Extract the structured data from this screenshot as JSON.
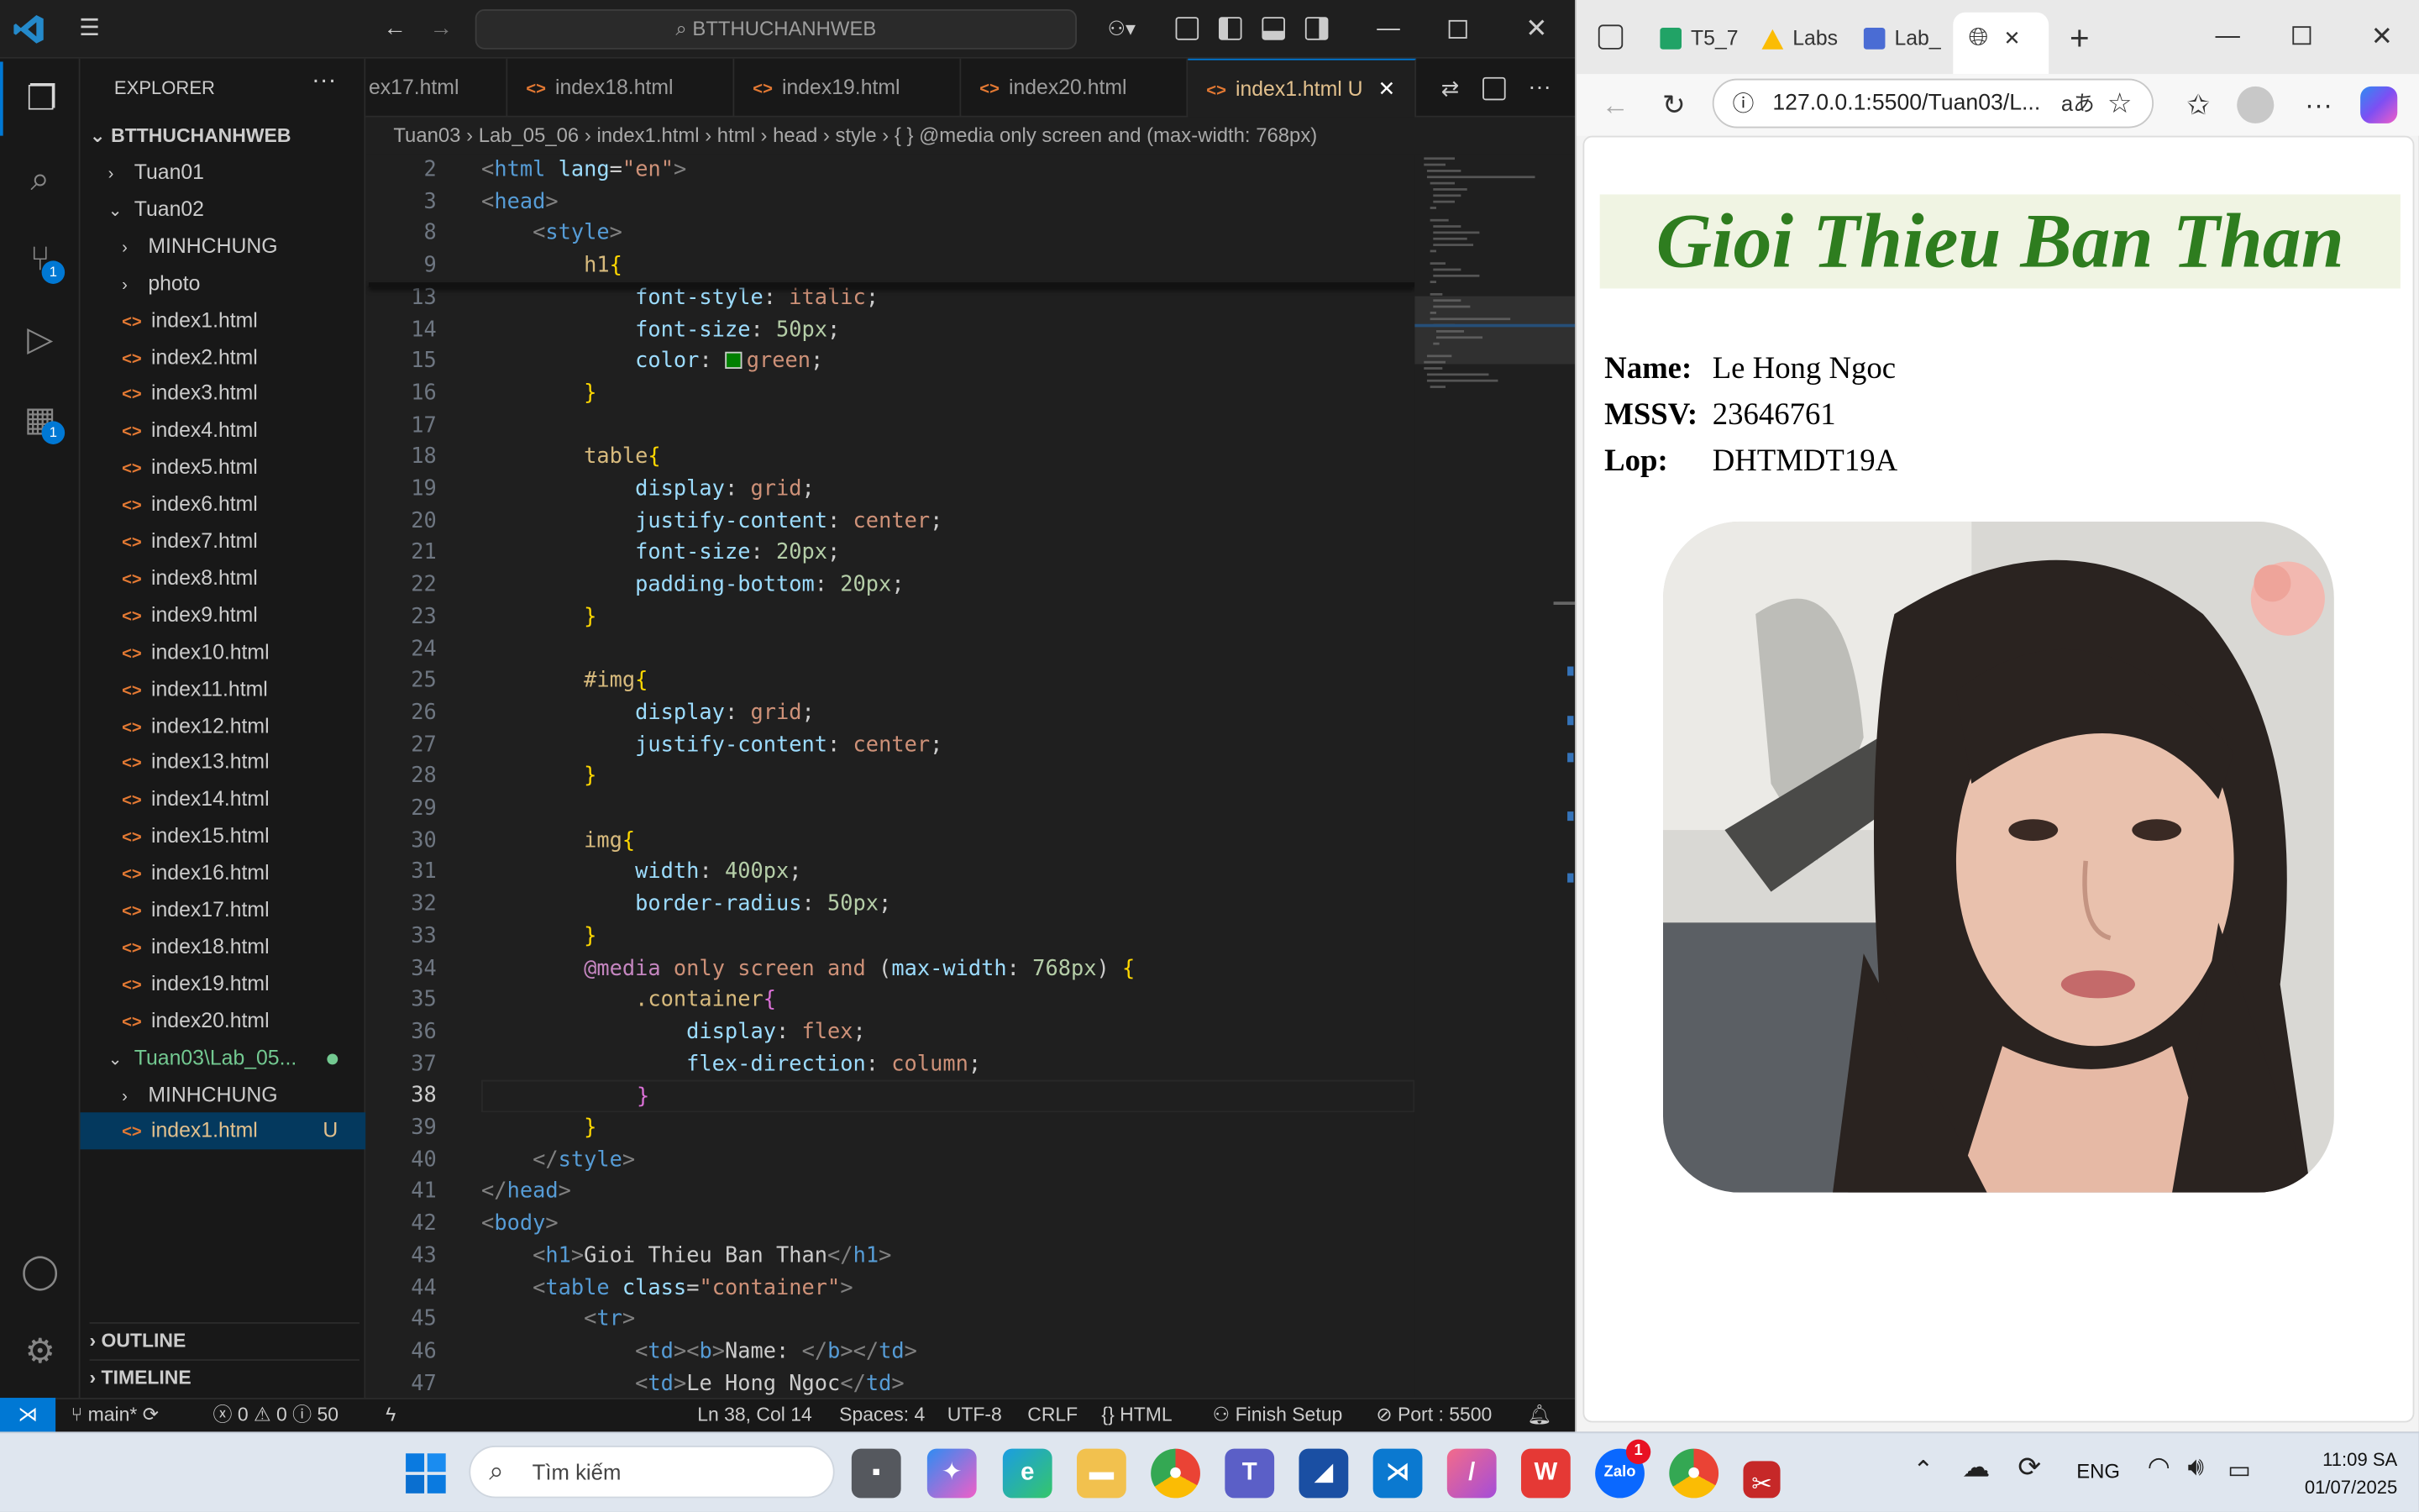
{
  "vscode": {
    "search": "BTTHUCHANHWEB",
    "explorer": {
      "title": "EXPLORER",
      "root": "BTTHUCHANHWEB",
      "items": [
        {
          "label": "Tuan01",
          "type": "folder",
          "open": false,
          "depth": 0
        },
        {
          "label": "Tuan02",
          "type": "folder",
          "open": true,
          "depth": 0
        },
        {
          "label": "MINHCHUNG",
          "type": "folder",
          "open": false,
          "depth": 1
        },
        {
          "label": "photo",
          "type": "folder",
          "open": false,
          "depth": 1
        },
        {
          "label": "index1.html",
          "type": "file",
          "depth": 1
        },
        {
          "label": "index2.html",
          "type": "file",
          "depth": 1
        },
        {
          "label": "index3.html",
          "type": "file",
          "depth": 1
        },
        {
          "label": "index4.html",
          "type": "file",
          "depth": 1
        },
        {
          "label": "index5.html",
          "type": "file",
          "depth": 1
        },
        {
          "label": "index6.html",
          "type": "file",
          "depth": 1
        },
        {
          "label": "index7.html",
          "type": "file",
          "depth": 1
        },
        {
          "label": "index8.html",
          "type": "file",
          "depth": 1
        },
        {
          "label": "index9.html",
          "type": "file",
          "depth": 1
        },
        {
          "label": "index10.html",
          "type": "file",
          "depth": 1
        },
        {
          "label": "index11.html",
          "type": "file",
          "depth": 1
        },
        {
          "label": "index12.html",
          "type": "file",
          "depth": 1
        },
        {
          "label": "index13.html",
          "type": "file",
          "depth": 1
        },
        {
          "label": "index14.html",
          "type": "file",
          "depth": 1
        },
        {
          "label": "index15.html",
          "type": "file",
          "depth": 1
        },
        {
          "label": "index16.html",
          "type": "file",
          "depth": 1
        },
        {
          "label": "index17.html",
          "type": "file",
          "depth": 1
        },
        {
          "label": "index18.html",
          "type": "file",
          "depth": 1
        },
        {
          "label": "index19.html",
          "type": "file",
          "depth": 1
        },
        {
          "label": "index20.html",
          "type": "file",
          "depth": 1
        },
        {
          "label": "Tuan03\\Lab_05...",
          "type": "folder",
          "open": true,
          "depth": 0,
          "modified": true
        },
        {
          "label": "MINHCHUNG",
          "type": "folder",
          "open": false,
          "depth": 1
        },
        {
          "label": "index1.html",
          "type": "file",
          "depth": 1,
          "selected": true,
          "badge": "U"
        }
      ],
      "outline": "OUTLINE",
      "timeline": "TIMELINE"
    },
    "tabs": [
      {
        "label": "ex17.html"
      },
      {
        "label": "index18.html"
      },
      {
        "label": "index19.html"
      },
      {
        "label": "index20.html"
      },
      {
        "label": "index1.html",
        "active": true,
        "badge": "U"
      }
    ],
    "breadcrumb": [
      "Tuan03",
      "Lab_05_06",
      "index1.html",
      "html",
      "head",
      "style",
      "{ } @media only screen and (max-width: 768px)"
    ],
    "code": [
      {
        "n": "2",
        "t": [
          [
            "tg",
            "<"
          ],
          [
            "kw",
            "html "
          ],
          [
            "at",
            "lang"
          ],
          [
            "tx",
            "="
          ],
          [
            "st",
            "\"en\""
          ],
          [
            "tg",
            ">"
          ]
        ]
      },
      {
        "n": "3",
        "t": [
          [
            "tg",
            "<"
          ],
          [
            "kw",
            "head"
          ],
          [
            "tg",
            ">"
          ]
        ]
      },
      {
        "n": "8",
        "t": [
          [
            "tx",
            "    "
          ],
          [
            "tg",
            "<"
          ],
          [
            "kw",
            "style"
          ],
          [
            "tg",
            ">"
          ]
        ]
      },
      {
        "n": "9",
        "t": [
          [
            "tx",
            "        "
          ],
          [
            "sl",
            "h1"
          ],
          [
            "br",
            "{"
          ]
        ]
      },
      {
        "n": "13",
        "t": [
          [
            "tx",
            "            "
          ],
          [
            "at",
            "font-style"
          ],
          [
            "tx",
            ": "
          ],
          [
            "st",
            "italic"
          ],
          [
            "tx",
            ";"
          ]
        ]
      },
      {
        "n": "14",
        "t": [
          [
            "tx",
            "            "
          ],
          [
            "at",
            "font-size"
          ],
          [
            "tx",
            ": "
          ],
          [
            "nm",
            "50px"
          ],
          [
            "tx",
            ";"
          ]
        ]
      },
      {
        "n": "15",
        "t": [
          [
            "tx",
            "            "
          ],
          [
            "at",
            "color"
          ],
          [
            "tx",
            ": "
          ],
          [
            "sw",
            "#008000"
          ],
          [
            "st",
            "green"
          ],
          [
            "tx",
            ";"
          ]
        ]
      },
      {
        "n": "16",
        "t": [
          [
            "tx",
            "        "
          ],
          [
            "br",
            "}"
          ]
        ]
      },
      {
        "n": "17",
        "t": []
      },
      {
        "n": "18",
        "t": [
          [
            "tx",
            "        "
          ],
          [
            "sl",
            "table"
          ],
          [
            "br",
            "{"
          ]
        ]
      },
      {
        "n": "19",
        "t": [
          [
            "tx",
            "            "
          ],
          [
            "at",
            "display"
          ],
          [
            "tx",
            ": "
          ],
          [
            "st",
            "grid"
          ],
          [
            "tx",
            ";"
          ]
        ]
      },
      {
        "n": "20",
        "t": [
          [
            "tx",
            "            "
          ],
          [
            "at",
            "justify-content"
          ],
          [
            "tx",
            ": "
          ],
          [
            "st",
            "center"
          ],
          [
            "tx",
            ";"
          ]
        ]
      },
      {
        "n": "21",
        "t": [
          [
            "tx",
            "            "
          ],
          [
            "at",
            "font-size"
          ],
          [
            "tx",
            ": "
          ],
          [
            "nm",
            "20px"
          ],
          [
            "tx",
            ";"
          ]
        ]
      },
      {
        "n": "22",
        "t": [
          [
            "tx",
            "            "
          ],
          [
            "at",
            "padding-bottom"
          ],
          [
            "tx",
            ": "
          ],
          [
            "nm",
            "20px"
          ],
          [
            "tx",
            ";"
          ]
        ]
      },
      {
        "n": "23",
        "t": [
          [
            "tx",
            "        "
          ],
          [
            "br",
            "}"
          ]
        ]
      },
      {
        "n": "24",
        "t": []
      },
      {
        "n": "25",
        "t": [
          [
            "tx",
            "        "
          ],
          [
            "sl",
            "#img"
          ],
          [
            "br",
            "{"
          ]
        ]
      },
      {
        "n": "26",
        "t": [
          [
            "tx",
            "            "
          ],
          [
            "at",
            "display"
          ],
          [
            "tx",
            ": "
          ],
          [
            "st",
            "grid"
          ],
          [
            "tx",
            ";"
          ]
        ]
      },
      {
        "n": "27",
        "t": [
          [
            "tx",
            "            "
          ],
          [
            "at",
            "justify-content"
          ],
          [
            "tx",
            ": "
          ],
          [
            "st",
            "center"
          ],
          [
            "tx",
            ";"
          ]
        ]
      },
      {
        "n": "28",
        "t": [
          [
            "tx",
            "        "
          ],
          [
            "br",
            "}"
          ]
        ]
      },
      {
        "n": "29",
        "t": []
      },
      {
        "n": "30",
        "t": [
          [
            "tx",
            "        "
          ],
          [
            "sl",
            "img"
          ],
          [
            "br",
            "{"
          ]
        ]
      },
      {
        "n": "31",
        "t": [
          [
            "tx",
            "            "
          ],
          [
            "at",
            "width"
          ],
          [
            "tx",
            ": "
          ],
          [
            "nm",
            "400px"
          ],
          [
            "tx",
            ";"
          ]
        ]
      },
      {
        "n": "32",
        "t": [
          [
            "tx",
            "            "
          ],
          [
            "at",
            "border-radius"
          ],
          [
            "tx",
            ": "
          ],
          [
            "nm",
            "50px"
          ],
          [
            "tx",
            ";"
          ]
        ]
      },
      {
        "n": "33",
        "t": [
          [
            "tx",
            "        "
          ],
          [
            "br",
            "}"
          ]
        ]
      },
      {
        "n": "34",
        "t": [
          [
            "tx",
            "        "
          ],
          [
            "pp",
            "@media"
          ],
          [
            "tx",
            " "
          ],
          [
            "st",
            "only screen"
          ],
          [
            "tx",
            " "
          ],
          [
            "st",
            "and"
          ],
          [
            "tx",
            " ("
          ],
          [
            "at",
            "max-width"
          ],
          [
            "tx",
            ": "
          ],
          [
            "nm",
            "768px"
          ],
          [
            "tx",
            ") "
          ],
          [
            "br",
            "{"
          ]
        ]
      },
      {
        "n": "35",
        "t": [
          [
            "tx",
            "            "
          ],
          [
            "sl",
            ".container"
          ],
          [
            "pk",
            "{"
          ]
        ]
      },
      {
        "n": "36",
        "t": [
          [
            "tx",
            "                "
          ],
          [
            "at",
            "display"
          ],
          [
            "tx",
            ": "
          ],
          [
            "st",
            "flex"
          ],
          [
            "tx",
            ";"
          ]
        ]
      },
      {
        "n": "37",
        "t": [
          [
            "tx",
            "                "
          ],
          [
            "at",
            "flex-direction"
          ],
          [
            "tx",
            ": "
          ],
          [
            "st",
            "column"
          ],
          [
            "tx",
            ";"
          ]
        ]
      },
      {
        "n": "38",
        "t": [
          [
            "tx",
            "            "
          ],
          [
            "pk",
            "}"
          ]
        ]
      },
      {
        "n": "39",
        "t": [
          [
            "tx",
            "        "
          ],
          [
            "br",
            "}"
          ]
        ]
      },
      {
        "n": "40",
        "t": [
          [
            "tx",
            "    "
          ],
          [
            "tg",
            "</"
          ],
          [
            "kw",
            "style"
          ],
          [
            "tg",
            ">"
          ]
        ]
      },
      {
        "n": "41",
        "t": [
          [
            "tg",
            "</"
          ],
          [
            "kw",
            "head"
          ],
          [
            "tg",
            ">"
          ]
        ]
      },
      {
        "n": "42",
        "t": [
          [
            "tg",
            "<"
          ],
          [
            "kw",
            "body"
          ],
          [
            "tg",
            ">"
          ]
        ]
      },
      {
        "n": "43",
        "t": [
          [
            "tx",
            "    "
          ],
          [
            "tg",
            "<"
          ],
          [
            "kw",
            "h1"
          ],
          [
            "tg",
            ">"
          ],
          [
            "tx",
            "Gioi Thieu Ban Than"
          ],
          [
            "tg",
            "</"
          ],
          [
            "kw",
            "h1"
          ],
          [
            "tg",
            ">"
          ]
        ]
      },
      {
        "n": "44",
        "t": [
          [
            "tx",
            "    "
          ],
          [
            "tg",
            "<"
          ],
          [
            "kw",
            "table "
          ],
          [
            "at",
            "class"
          ],
          [
            "tx",
            "="
          ],
          [
            "st",
            "\"container\""
          ],
          [
            "tg",
            ">"
          ]
        ]
      },
      {
        "n": "45",
        "t": [
          [
            "tx",
            "        "
          ],
          [
            "tg",
            "<"
          ],
          [
            "kw",
            "tr"
          ],
          [
            "tg",
            ">"
          ]
        ]
      },
      {
        "n": "46",
        "t": [
          [
            "tx",
            "            "
          ],
          [
            "tg",
            "<"
          ],
          [
            "kw",
            "td"
          ],
          [
            "tg",
            "><"
          ],
          [
            "kw",
            "b"
          ],
          [
            "tg",
            ">"
          ],
          [
            "tx",
            "Name: "
          ],
          [
            "tg",
            "</"
          ],
          [
            "kw",
            "b"
          ],
          [
            "tg",
            "></"
          ],
          [
            "kw",
            "td"
          ],
          [
            "tg",
            ">"
          ]
        ]
      },
      {
        "n": "47",
        "t": [
          [
            "tx",
            "            "
          ],
          [
            "tg",
            "<"
          ],
          [
            "kw",
            "td"
          ],
          [
            "tg",
            ">"
          ],
          [
            "tx",
            "Le Hong Ngoc"
          ],
          [
            "tg",
            "</"
          ],
          [
            "kw",
            "td"
          ],
          [
            "tg",
            ">"
          ]
        ]
      }
    ],
    "status": {
      "branch": "main*",
      "problems": "0",
      "warnings": "0",
      "infos": "50",
      "position": "Ln 38, Col 14",
      "spaces": "Spaces: 4",
      "encoding": "UTF-8",
      "eol": "CRLF",
      "language": "HTML",
      "setup": "Finish Setup",
      "port": "Port : 5500"
    },
    "activity_badges": {
      "scm": "1",
      "extensions": "1"
    }
  },
  "browser": {
    "tabs": [
      {
        "label": "T5_7"
      },
      {
        "label": "Labs"
      },
      {
        "label": "Lab_"
      },
      {
        "label": "",
        "active": true
      }
    ],
    "url": "127.0.0.1:5500/Tuan03/L...",
    "page": {
      "heading": "Gioi Thieu Ban Than",
      "rows": [
        {
          "label": "Name:",
          "value": "Le Hong Ngoc"
        },
        {
          "label": "MSSV:",
          "value": "23646761"
        },
        {
          "label": "Lop:",
          "value": "DHTMDT19A"
        }
      ],
      "heading_color": "#2e7d1f",
      "heading_bg": "#f0f4e3"
    }
  },
  "taskbar": {
    "search": "Tìm kiếm",
    "language": "ENG",
    "time": "11:09 SA",
    "date": "01/07/2025",
    "zalo_badge": "1"
  }
}
